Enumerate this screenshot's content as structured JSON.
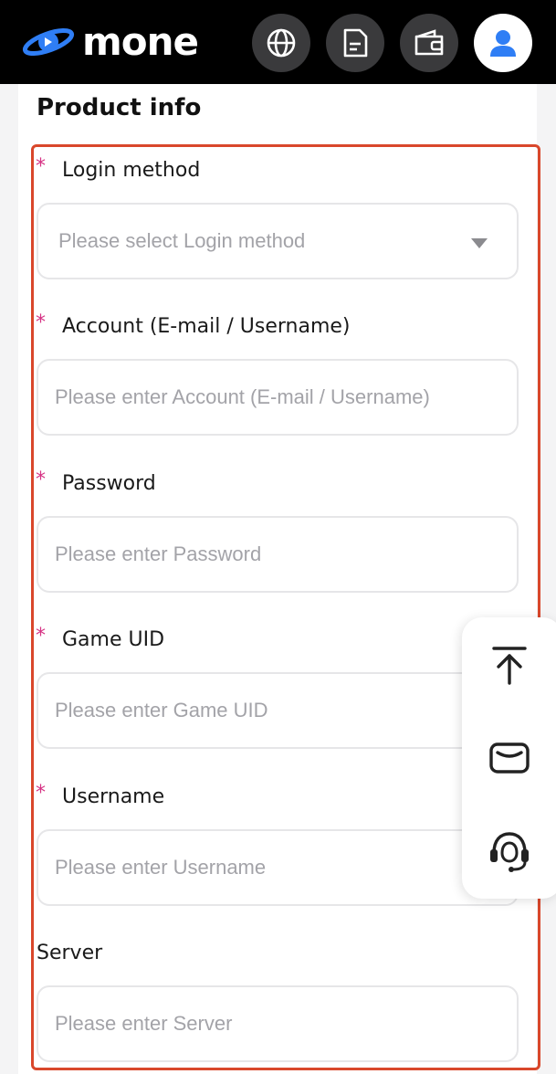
{
  "header": {
    "logo_text": "mone",
    "icons": [
      "globe-icon",
      "document-icon",
      "wallet-icon",
      "user-icon"
    ]
  },
  "card": {
    "title": "Product info"
  },
  "form": {
    "login_method": {
      "label": "Login method",
      "required": true,
      "placeholder": "Please select Login method"
    },
    "account": {
      "label": "Account (E-mail / Username)",
      "required": true,
      "placeholder": "Please enter Account (E-mail / Username)"
    },
    "password": {
      "label": "Password",
      "required": true,
      "placeholder": "Please enter Password"
    },
    "game_uid": {
      "label": "Game UID",
      "required": true,
      "placeholder": "Please enter Game UID"
    },
    "username": {
      "label": "Username",
      "required": true,
      "placeholder": "Please enter Username"
    },
    "server": {
      "label": "Server",
      "required": false,
      "placeholder": "Please enter Server"
    },
    "required_mark": "*"
  },
  "side_panel": {
    "icons": [
      "back-to-top-icon",
      "mail-icon",
      "support-headset-icon"
    ]
  },
  "colors": {
    "header_bg": "#000000",
    "required_mark": "#d63384",
    "highlight_border": "#d9472b",
    "brand_blue": "#2f7ef5"
  }
}
